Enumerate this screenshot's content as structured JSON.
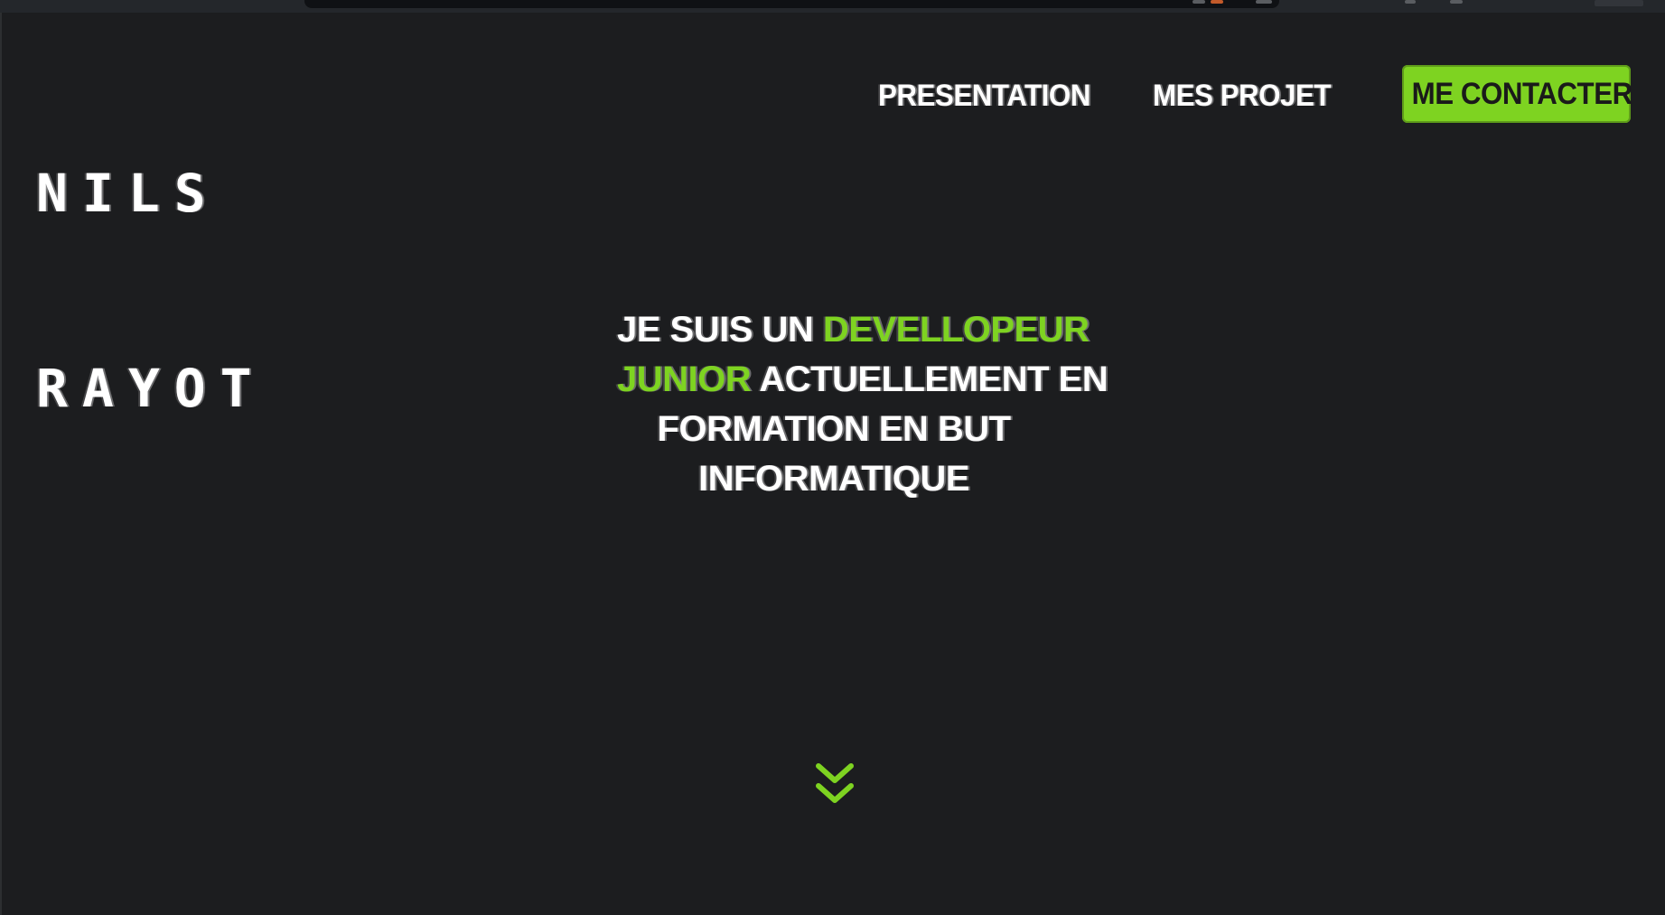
{
  "logo": {
    "line1": "NILS",
    "line2": "RAYOT"
  },
  "nav": {
    "presentation": "PRESENTATION",
    "projects": "MES PROJET",
    "contact": "ME CONTACTER"
  },
  "hero": {
    "line1_a": "JE SUIS UN ",
    "line1_b": "DEVELLOPEUR",
    "line2_a": "JUNIOR",
    "line2_b": " ACTUELLEMENT EN",
    "line3": "FORMATION EN BUT",
    "line4": "INFORMATIQUE"
  },
  "icons": {
    "scroll": "double-chevron-down-icon"
  },
  "colors": {
    "background": "#1c1d1f",
    "accent": "#7ed321",
    "text": "#ffffff"
  }
}
